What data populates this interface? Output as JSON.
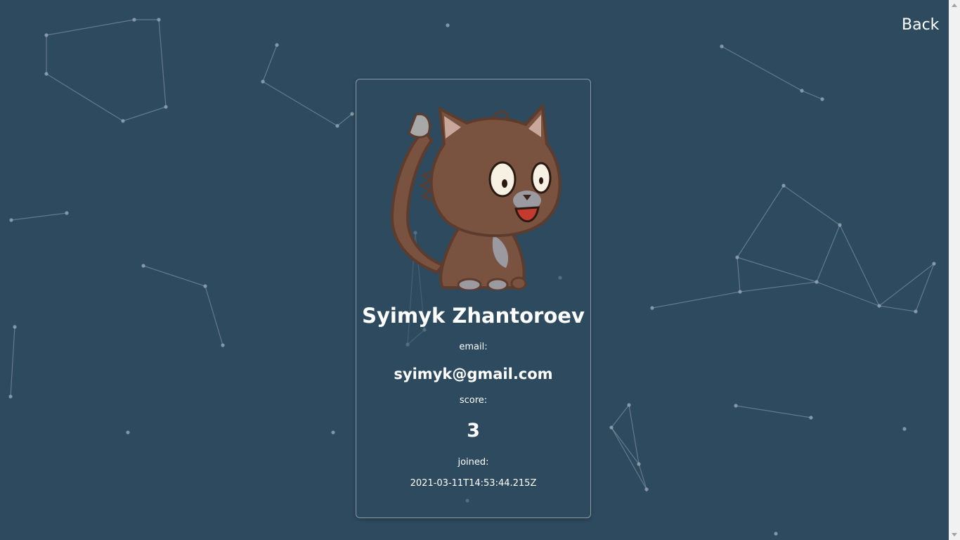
{
  "nav": {
    "back_label": "Back"
  },
  "profile": {
    "name": "Syimyk Zhantoroev",
    "email_label": "email:",
    "email": "syimyk@gmail.com",
    "score_label": "score:",
    "score": "3",
    "joined_label": "joined:",
    "joined": "2021-03-11T14:53:44.215Z"
  },
  "colors": {
    "background": "#2e4a5e",
    "text": "#ffffff",
    "network": "#8fa3b3"
  },
  "icons": {
    "avatar": "cartoon-cat-avatar"
  }
}
